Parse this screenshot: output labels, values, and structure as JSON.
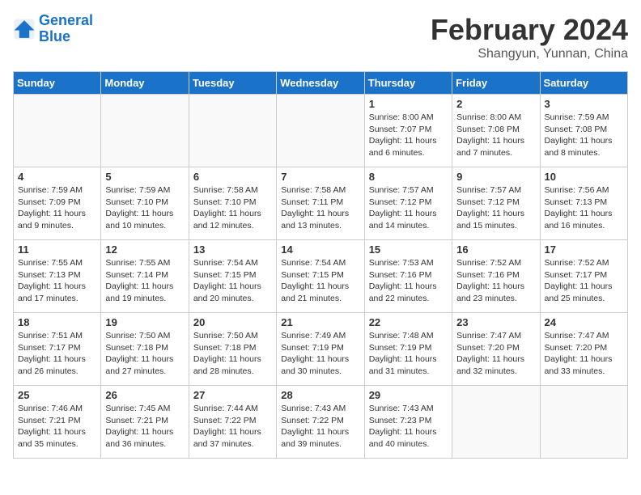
{
  "logo": {
    "line1": "General",
    "line2": "Blue"
  },
  "title": {
    "month_year": "February 2024",
    "location": "Shangyun, Yunnan, China"
  },
  "days_of_week": [
    "Sunday",
    "Monday",
    "Tuesday",
    "Wednesday",
    "Thursday",
    "Friday",
    "Saturday"
  ],
  "weeks": [
    [
      {
        "day": "",
        "info": ""
      },
      {
        "day": "",
        "info": ""
      },
      {
        "day": "",
        "info": ""
      },
      {
        "day": "",
        "info": ""
      },
      {
        "day": "1",
        "info": "Sunrise: 8:00 AM\nSunset: 7:07 PM\nDaylight: 11 hours and 6 minutes."
      },
      {
        "day": "2",
        "info": "Sunrise: 8:00 AM\nSunset: 7:08 PM\nDaylight: 11 hours and 7 minutes."
      },
      {
        "day": "3",
        "info": "Sunrise: 7:59 AM\nSunset: 7:08 PM\nDaylight: 11 hours and 8 minutes."
      }
    ],
    [
      {
        "day": "4",
        "info": "Sunrise: 7:59 AM\nSunset: 7:09 PM\nDaylight: 11 hours and 9 minutes."
      },
      {
        "day": "5",
        "info": "Sunrise: 7:59 AM\nSunset: 7:10 PM\nDaylight: 11 hours and 10 minutes."
      },
      {
        "day": "6",
        "info": "Sunrise: 7:58 AM\nSunset: 7:10 PM\nDaylight: 11 hours and 12 minutes."
      },
      {
        "day": "7",
        "info": "Sunrise: 7:58 AM\nSunset: 7:11 PM\nDaylight: 11 hours and 13 minutes."
      },
      {
        "day": "8",
        "info": "Sunrise: 7:57 AM\nSunset: 7:12 PM\nDaylight: 11 hours and 14 minutes."
      },
      {
        "day": "9",
        "info": "Sunrise: 7:57 AM\nSunset: 7:12 PM\nDaylight: 11 hours and 15 minutes."
      },
      {
        "day": "10",
        "info": "Sunrise: 7:56 AM\nSunset: 7:13 PM\nDaylight: 11 hours and 16 minutes."
      }
    ],
    [
      {
        "day": "11",
        "info": "Sunrise: 7:55 AM\nSunset: 7:13 PM\nDaylight: 11 hours and 17 minutes."
      },
      {
        "day": "12",
        "info": "Sunrise: 7:55 AM\nSunset: 7:14 PM\nDaylight: 11 hours and 19 minutes."
      },
      {
        "day": "13",
        "info": "Sunrise: 7:54 AM\nSunset: 7:15 PM\nDaylight: 11 hours and 20 minutes."
      },
      {
        "day": "14",
        "info": "Sunrise: 7:54 AM\nSunset: 7:15 PM\nDaylight: 11 hours and 21 minutes."
      },
      {
        "day": "15",
        "info": "Sunrise: 7:53 AM\nSunset: 7:16 PM\nDaylight: 11 hours and 22 minutes."
      },
      {
        "day": "16",
        "info": "Sunrise: 7:52 AM\nSunset: 7:16 PM\nDaylight: 11 hours and 23 minutes."
      },
      {
        "day": "17",
        "info": "Sunrise: 7:52 AM\nSunset: 7:17 PM\nDaylight: 11 hours and 25 minutes."
      }
    ],
    [
      {
        "day": "18",
        "info": "Sunrise: 7:51 AM\nSunset: 7:17 PM\nDaylight: 11 hours and 26 minutes."
      },
      {
        "day": "19",
        "info": "Sunrise: 7:50 AM\nSunset: 7:18 PM\nDaylight: 11 hours and 27 minutes."
      },
      {
        "day": "20",
        "info": "Sunrise: 7:50 AM\nSunset: 7:18 PM\nDaylight: 11 hours and 28 minutes."
      },
      {
        "day": "21",
        "info": "Sunrise: 7:49 AM\nSunset: 7:19 PM\nDaylight: 11 hours and 30 minutes."
      },
      {
        "day": "22",
        "info": "Sunrise: 7:48 AM\nSunset: 7:19 PM\nDaylight: 11 hours and 31 minutes."
      },
      {
        "day": "23",
        "info": "Sunrise: 7:47 AM\nSunset: 7:20 PM\nDaylight: 11 hours and 32 minutes."
      },
      {
        "day": "24",
        "info": "Sunrise: 7:47 AM\nSunset: 7:20 PM\nDaylight: 11 hours and 33 minutes."
      }
    ],
    [
      {
        "day": "25",
        "info": "Sunrise: 7:46 AM\nSunset: 7:21 PM\nDaylight: 11 hours and 35 minutes."
      },
      {
        "day": "26",
        "info": "Sunrise: 7:45 AM\nSunset: 7:21 PM\nDaylight: 11 hours and 36 minutes."
      },
      {
        "day": "27",
        "info": "Sunrise: 7:44 AM\nSunset: 7:22 PM\nDaylight: 11 hours and 37 minutes."
      },
      {
        "day": "28",
        "info": "Sunrise: 7:43 AM\nSunset: 7:22 PM\nDaylight: 11 hours and 39 minutes."
      },
      {
        "day": "29",
        "info": "Sunrise: 7:43 AM\nSunset: 7:23 PM\nDaylight: 11 hours and 40 minutes."
      },
      {
        "day": "",
        "info": ""
      },
      {
        "day": "",
        "info": ""
      }
    ]
  ]
}
